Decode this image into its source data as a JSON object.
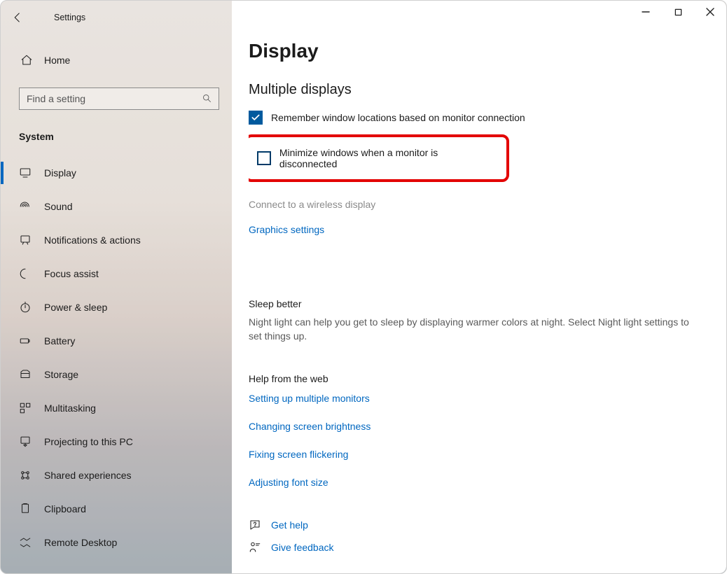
{
  "window": {
    "title": "Settings"
  },
  "sidebar": {
    "home": "Home",
    "search_placeholder": "Find a setting",
    "category": "System",
    "items": [
      {
        "label": "Display",
        "selected": true
      },
      {
        "label": "Sound",
        "selected": false
      },
      {
        "label": "Notifications & actions",
        "selected": false
      },
      {
        "label": "Focus assist",
        "selected": false
      },
      {
        "label": "Power & sleep",
        "selected": false
      },
      {
        "label": "Battery",
        "selected": false
      },
      {
        "label": "Storage",
        "selected": false
      },
      {
        "label": "Multitasking",
        "selected": false
      },
      {
        "label": "Projecting to this PC",
        "selected": false
      },
      {
        "label": "Shared experiences",
        "selected": false
      },
      {
        "label": "Clipboard",
        "selected": false
      },
      {
        "label": "Remote Desktop",
        "selected": false
      }
    ]
  },
  "main": {
    "page_title": "Display",
    "section_multiple": "Multiple displays",
    "chk_remember": "Remember window locations based on monitor connection",
    "chk_minimize": "Minimize windows when a monitor is disconnected",
    "wireless": "Connect to a wireless display",
    "graphics": "Graphics settings",
    "sleep_h": "Sleep better",
    "sleep_body": "Night light can help you get to sleep by displaying warmer colors at night. Select Night light settings to set things up.",
    "help_h": "Help from the web",
    "help_links": [
      "Setting up multiple monitors",
      "Changing screen brightness",
      "Fixing screen flickering",
      "Adjusting font size"
    ],
    "get_help": "Get help",
    "feedback": "Give feedback"
  },
  "highlight": {
    "target": "chk_minimize"
  }
}
